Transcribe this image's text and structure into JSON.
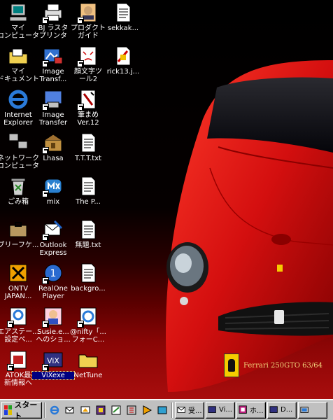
{
  "desktop": {
    "icons": [
      {
        "label": "マイ\nコンピュータ",
        "icon": "my-computer-icon"
      },
      {
        "label": "BJ ラスタ\nプリンタ",
        "icon": "printer-icon"
      },
      {
        "label": "プロダクト\nガイド",
        "icon": "product-guide-icon"
      },
      {
        "label": "sekkak...",
        "icon": "text-file-icon"
      },
      {
        "label": "マイ\nドキュメント",
        "icon": "my-documents-folder-icon"
      },
      {
        "label": "Image\nTransf...",
        "icon": "image-transfer-icon"
      },
      {
        "label": "顔文字ツ\nール2",
        "icon": "emoticon-tool-icon"
      },
      {
        "label": "rick13.j...",
        "icon": "image-file-icon"
      },
      {
        "label": "Internet\nExplorer",
        "icon": "internet-explorer-icon"
      },
      {
        "label": "Image\nTransfer",
        "icon": "image-transfer-app-icon"
      },
      {
        "label": "筆まめ\nVer.12",
        "icon": "fudemame-icon"
      },
      {
        "label": "ネットワーク\nコンピュータ",
        "icon": "network-computer-icon"
      },
      {
        "label": "Lhasa",
        "icon": "lhasa-archiver-icon"
      },
      {
        "label": "T.T.T.txt",
        "icon": "text-file-icon"
      },
      {
        "label": "ごみ箱",
        "icon": "recycle-bin-icon"
      },
      {
        "label": "mix",
        "icon": "mix-app-icon"
      },
      {
        "label": "The  P...",
        "icon": "text-file-icon"
      },
      {
        "label": "ブリーフケ...",
        "icon": "briefcase-icon"
      },
      {
        "label": "Outlook\nExpress",
        "icon": "outlook-express-icon"
      },
      {
        "label": "無題.txt",
        "icon": "text-file-icon"
      },
      {
        "label": "ONTV\nJAPAN...",
        "icon": "ontv-japan-icon"
      },
      {
        "label": "RealOne\nPlayer",
        "icon": "realone-player-icon"
      },
      {
        "label": "backgro...",
        "icon": "text-file-icon"
      },
      {
        "label": "エアステー...\n設定ペ...",
        "icon": "airstation-settings-icon"
      },
      {
        "label": "Susie.e...\nへのショ...",
        "icon": "susie-viewer-icon"
      },
      {
        "label": "@nifty「...\nフォーC...",
        "icon": "nifty-ie-shortcut-icon"
      },
      {
        "label": "ATOK最\n新情報へ",
        "icon": "atok-info-icon"
      },
      {
        "label": "ViXexe",
        "icon": "vix-app-icon"
      },
      {
        "label": "NetTune",
        "icon": "folder-icon"
      }
    ],
    "wallpaper_caption": "Ferrari 250GTO 63/64"
  },
  "taskbar": {
    "start_label": "スタート",
    "quick_launch": [
      {
        "icon": "internet-explorer-icon"
      },
      {
        "icon": "outlook-express-icon"
      },
      {
        "icon": "show-desktop-icon"
      },
      {
        "icon": "app-shortcut-icon"
      },
      {
        "icon": "folder-shortcut-icon"
      },
      {
        "icon": "channels-icon"
      },
      {
        "icon": "media-player-icon"
      },
      {
        "icon": "app-launcher-icon"
      }
    ],
    "tasks": [
      {
        "label": "受...",
        "icon": "inbox-icon"
      },
      {
        "label": "Vi...",
        "icon": "vix-app-icon"
      },
      {
        "label": "ホ...",
        "icon": "home-app-icon"
      },
      {
        "label": "D...",
        "icon": "vix-app-icon"
      },
      {
        "label": "",
        "icon": "explorer-icon"
      }
    ]
  },
  "colors": {
    "wallpaper_body": "#d40f0f",
    "taskbar": "#c0c0c0",
    "selection": "#000080",
    "caption_text": "#f0d27a"
  }
}
